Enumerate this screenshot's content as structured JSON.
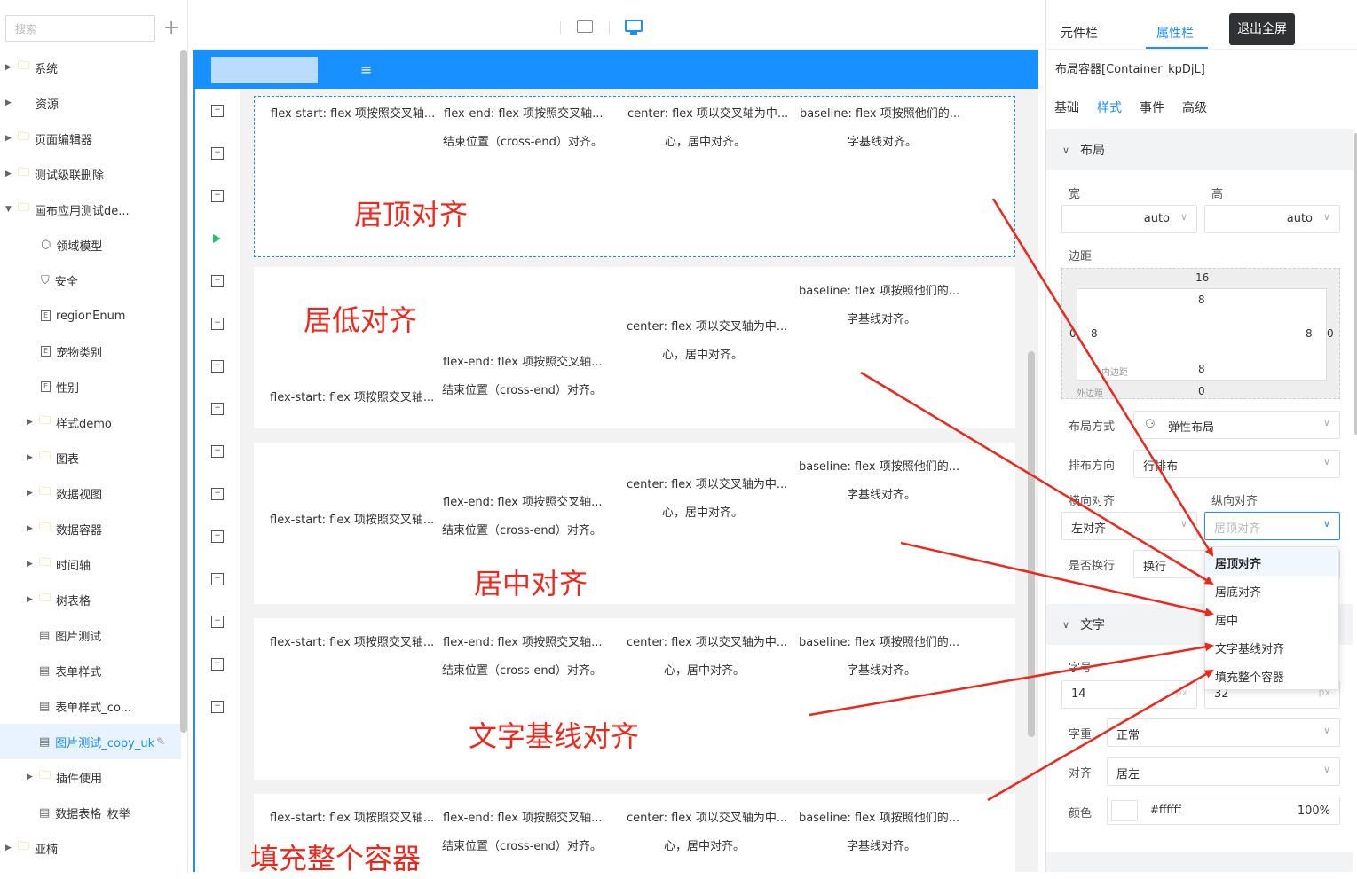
{
  "left": {
    "search_placeholder": "搜索",
    "add_icon": "+",
    "items": [
      {
        "label": "系统",
        "arrow": "▶",
        "icon": "folder"
      },
      {
        "label": "资源",
        "arrow": "▶",
        "icon": ""
      },
      {
        "label": "页面编辑器",
        "arrow": "▶",
        "icon": "folder"
      },
      {
        "label": "测试级联删除",
        "arrow": "▶",
        "icon": "folder"
      },
      {
        "label": "画布应用测试de...",
        "arrow": "▼",
        "icon": "folder"
      },
      {
        "label": "领域模型",
        "arrow": "",
        "icon": "cube"
      },
      {
        "label": "安全",
        "arrow": "",
        "icon": "shield"
      },
      {
        "label": "regionEnum",
        "arrow": "",
        "icon": "enum"
      },
      {
        "label": "宠物类别",
        "arrow": "",
        "icon": "enum"
      },
      {
        "label": "性别",
        "arrow": "",
        "icon": "enum"
      },
      {
        "label": "样式demo",
        "arrow": "▶",
        "icon": "folder"
      },
      {
        "label": "图表",
        "arrow": "▶",
        "icon": "folder"
      },
      {
        "label": "数据视图",
        "arrow": "▶",
        "icon": "folder"
      },
      {
        "label": "数据容器",
        "arrow": "▶",
        "icon": "folder"
      },
      {
        "label": "时间轴",
        "arrow": "▶",
        "icon": "folder"
      },
      {
        "label": "树表格",
        "arrow": "▶",
        "icon": "folder"
      },
      {
        "label": "图片测试",
        "arrow": "",
        "icon": "page"
      },
      {
        "label": "表单样式",
        "arrow": "",
        "icon": "page"
      },
      {
        "label": "表单样式_co...",
        "arrow": "",
        "icon": "page"
      },
      {
        "label": "图片测试_copy_uk",
        "arrow": "",
        "icon": "page"
      },
      {
        "label": "插件使用",
        "arrow": "▶",
        "icon": "folder"
      },
      {
        "label": "数据表格_枚举",
        "arrow": "",
        "icon": "page"
      },
      {
        "label": "亚楠",
        "arrow": "▶",
        "icon": "folder"
      }
    ]
  },
  "canvas": {
    "t_start": "flex-start: flex 项按照交叉轴...",
    "t_end1": "flex-end: flex 项按照交叉轴...",
    "t_end2": "结束位置（cross-end）对齐。",
    "t_center1": "center: flex 项以交叉轴为中...",
    "t_center2": "心，居中对齐。",
    "t_base1": "baseline: flex 项按照他们的...",
    "t_base2": "字基线对齐。",
    "notes": [
      "居顶对齐",
      "居低对齐",
      "居中对齐",
      "文字基线对齐",
      "填充整个容器"
    ]
  },
  "right": {
    "tabs": [
      "元件栏",
      "属性栏"
    ],
    "fullscreen": "退出全屏",
    "component": "布局容器[Container_kpDjL]",
    "subtabs": [
      "基础",
      "样式",
      "事件",
      "高级"
    ],
    "section_layout": "布局",
    "width_label": "宽",
    "height_label": "高",
    "auto": "auto",
    "margin_label": "边距",
    "bm": {
      "mt": "16",
      "pt": "8",
      "ml": "0",
      "pl": "8",
      "pr": "8",
      "mr": "0",
      "pb": "8",
      "mb": "0",
      "inner_label": "内边距",
      "outer_label": "外边距"
    },
    "layout_mode_label": "布局方式",
    "layout_mode": "弹性布局",
    "direction_label": "排布方向",
    "direction": "行排布",
    "h_align_label": "横向对齐",
    "v_align_label": "纵向对齐",
    "h_align": "左对齐",
    "v_align_placeholder": "居顶对齐",
    "wrap_label": "是否换行",
    "wrap": "换行",
    "section_text": "文字",
    "font_size_label": "字号",
    "font_size": "14",
    "line_height": "32",
    "px": "px",
    "weight_label": "字重",
    "weight": "正常",
    "align_label": "对齐",
    "align": "居左",
    "color_label": "颜色",
    "color": "#ffffff",
    "opacity": "100%",
    "dropdown": [
      "居顶对齐",
      "居底对齐",
      "居中",
      "文字基线对齐",
      "填充整个容器"
    ]
  }
}
